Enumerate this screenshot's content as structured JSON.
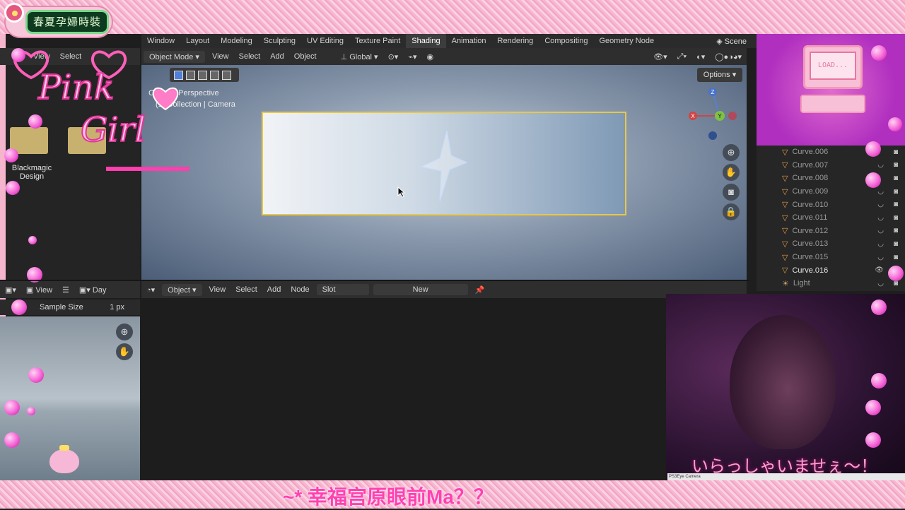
{
  "app": {
    "name": "Blender"
  },
  "banner": {
    "sign_text": "春夏孕婦時裝",
    "logo_text_line1": "Pink",
    "logo_text_line2": "Girl",
    "bottom_text": "~* 幸福宫原眼前Ma？？"
  },
  "workspace_tabs": [
    {
      "label": "Window"
    },
    {
      "label": "Layout"
    },
    {
      "label": "Modeling"
    },
    {
      "label": "Sculpting"
    },
    {
      "label": "UV Editing"
    },
    {
      "label": "Texture Paint"
    },
    {
      "label": "Shading",
      "active": true
    },
    {
      "label": "Animation"
    },
    {
      "label": "Rendering"
    },
    {
      "label": "Compositing"
    },
    {
      "label": "Geometry Node"
    }
  ],
  "scene": {
    "label": "Scene"
  },
  "left_header": {
    "view": "View",
    "select": "Select"
  },
  "viewport_header": {
    "mode": "Object Mode",
    "view": "View",
    "select": "Select",
    "add": "Add",
    "object": "Object",
    "orientation": "Global"
  },
  "viewport": {
    "overlay_line1": "Camera Perspective",
    "overlay_line2": "(1) Collection | Camera",
    "options": "Options",
    "gizmo": {
      "x": "X",
      "y": "Y",
      "z": "Z"
    }
  },
  "file_browser": {
    "folder_label": "Blackmagic Design"
  },
  "image_editor": {
    "view": "View",
    "image_name": "Day",
    "sample_size_label": "Sample Size",
    "sample_size_value": "1 px"
  },
  "node_header": {
    "object_dropdown": "Object",
    "view": "View",
    "select": "Select",
    "add": "Add",
    "node": "Node",
    "slot": "Slot",
    "new": "New"
  },
  "outliner": {
    "items": [
      {
        "name": "Curve.006"
      },
      {
        "name": "Curve.007"
      },
      {
        "name": "Curve.008"
      },
      {
        "name": "Curve.009"
      },
      {
        "name": "Curve.010"
      },
      {
        "name": "Curve.011"
      },
      {
        "name": "Curve.012"
      },
      {
        "name": "Curve.013"
      },
      {
        "name": "Curve.015"
      },
      {
        "name": "Curve.016",
        "selected": true
      },
      {
        "name": "Light"
      }
    ]
  },
  "load_panel": {
    "text": "LOAD..."
  },
  "webcam": {
    "caption": "いらっしゃいませぇ～！",
    "device_label": "PS3Eye Camera"
  },
  "colors": {
    "accent": "#4f7fd9",
    "frame": "#e9c845",
    "pink": "#ff41b0"
  }
}
